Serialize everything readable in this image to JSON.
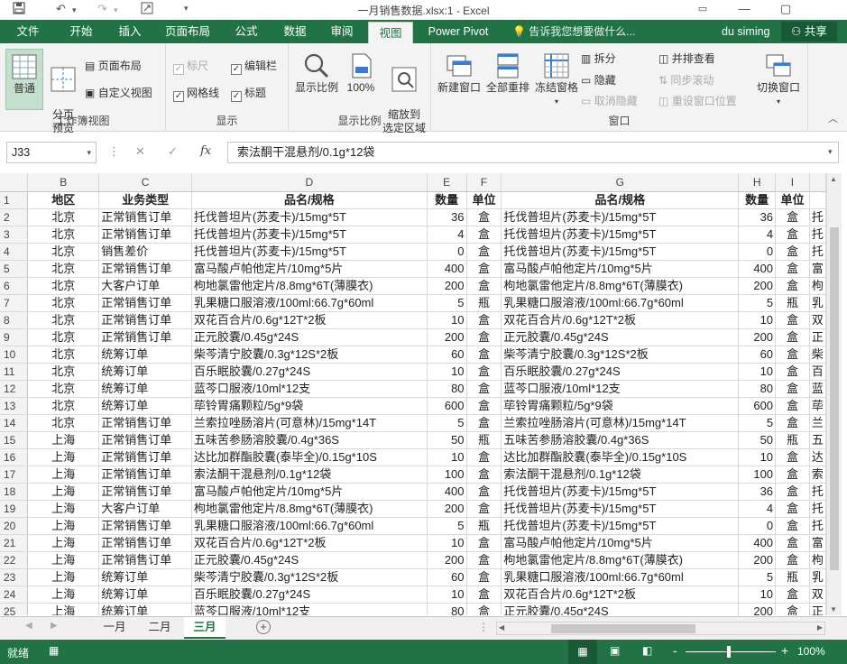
{
  "window": {
    "title": "一月销售数据.xlsx:1 - Excel",
    "minimize": "—",
    "restore": "▢",
    "ribbon_toggle": "▭"
  },
  "ribbon_tabs": [
    {
      "label": "文件"
    },
    {
      "label": "开始"
    },
    {
      "label": "插入"
    },
    {
      "label": "页面布局"
    },
    {
      "label": "公式"
    },
    {
      "label": "数据"
    },
    {
      "label": "审阅"
    },
    {
      "label": "视图"
    },
    {
      "label": "Power Pivot"
    }
  ],
  "tell_me": "告诉我您想要做什么...",
  "user": "du siming",
  "share": "共享",
  "ribbon": {
    "workbook_views": {
      "normal": "普通",
      "page_break": "分页\n预览",
      "page_layout": "页面布局",
      "custom_views": "自定义视图",
      "group_label": "工作簿视图"
    },
    "show": {
      "ruler": "标尺",
      "formula_bar": "编辑栏",
      "gridlines": "网格线",
      "headings": "标题",
      "group_label": "显示"
    },
    "zoom": {
      "zoom": "显示比例",
      "hundred": "100%",
      "zoom_to_selection": "缩放到\n选定区域",
      "group_label": "显示比例"
    },
    "window": {
      "new_window": "新建窗口",
      "arrange_all": "全部重排",
      "freeze_panes": "冻结窗格",
      "split": "拆分",
      "hide": "隐藏",
      "unhide": "取消隐藏",
      "side_by_side": "并排查看",
      "sync_scroll": "同步滚动",
      "reset_position": "重设窗口位置",
      "switch_windows": "切换窗口",
      "group_label": "窗口"
    }
  },
  "formula_bar": {
    "name_box": "J33",
    "cancel": "✕",
    "enter": "✓",
    "fx": "fx",
    "content": "索法酮干混悬剂/0.1g*12袋"
  },
  "columns": [
    "B",
    "C",
    "D",
    "E",
    "F",
    "G",
    "H",
    "I"
  ],
  "header_row": {
    "num": "1",
    "cells": [
      "地区",
      "业务类型",
      "品名/规格",
      "数量",
      "单位",
      "品名/规格",
      "数量",
      "单位"
    ]
  },
  "rows": [
    {
      "num": "2",
      "cells": [
        "北京",
        "正常销售订单",
        "托伐普坦片(苏麦卡)/15mg*5T",
        "36",
        "盒",
        "托伐普坦片(苏麦卡)/15mg*5T",
        "36",
        "盒",
        "托"
      ]
    },
    {
      "num": "3",
      "cells": [
        "北京",
        "正常销售订单",
        "托伐普坦片(苏麦卡)/15mg*5T",
        "4",
        "盒",
        "托伐普坦片(苏麦卡)/15mg*5T",
        "4",
        "盒",
        "托"
      ]
    },
    {
      "num": "4",
      "cells": [
        "北京",
        "销售差价",
        "托伐普坦片(苏麦卡)/15mg*5T",
        "0",
        "盒",
        "托伐普坦片(苏麦卡)/15mg*5T",
        "0",
        "盒",
        "托"
      ]
    },
    {
      "num": "5",
      "cells": [
        "北京",
        "正常销售订单",
        "富马酸卢帕他定片/10mg*5片",
        "400",
        "盒",
        "富马酸卢帕他定片/10mg*5片",
        "400",
        "盒",
        "富"
      ]
    },
    {
      "num": "6",
      "cells": [
        "北京",
        "大客户订单",
        "枸地氯雷他定片/8.8mg*6T(薄膜衣)",
        "200",
        "盒",
        "枸地氯雷他定片/8.8mg*6T(薄膜衣)",
        "200",
        "盒",
        "枸"
      ]
    },
    {
      "num": "7",
      "cells": [
        "北京",
        "正常销售订单",
        "乳果糖口服溶液/100ml:66.7g*60ml",
        "5",
        "瓶",
        "乳果糖口服溶液/100ml:66.7g*60ml",
        "5",
        "瓶",
        "乳"
      ]
    },
    {
      "num": "8",
      "cells": [
        "北京",
        "正常销售订单",
        "双花百合片/0.6g*12T*2板",
        "10",
        "盒",
        "双花百合片/0.6g*12T*2板",
        "10",
        "盒",
        "双"
      ]
    },
    {
      "num": "9",
      "cells": [
        "北京",
        "正常销售订单",
        "正元胶囊/0.45g*24S",
        "200",
        "盒",
        "正元胶囊/0.45g*24S",
        "200",
        "盒",
        "正"
      ]
    },
    {
      "num": "10",
      "cells": [
        "北京",
        "统筹订单",
        "柴芩清宁胶囊/0.3g*12S*2板",
        "60",
        "盒",
        "柴芩清宁胶囊/0.3g*12S*2板",
        "60",
        "盒",
        "柴"
      ]
    },
    {
      "num": "11",
      "cells": [
        "北京",
        "统筹订单",
        "百乐眠胶囊/0.27g*24S",
        "10",
        "盒",
        "百乐眠胶囊/0.27g*24S",
        "10",
        "盒",
        "百"
      ]
    },
    {
      "num": "12",
      "cells": [
        "北京",
        "统筹订单",
        "蓝芩口服液/10ml*12支",
        "80",
        "盒",
        "蓝芩口服液/10ml*12支",
        "80",
        "盒",
        "蓝"
      ]
    },
    {
      "num": "13",
      "cells": [
        "北京",
        "统筹订单",
        "荜铃胃痛颗粒/5g*9袋",
        "600",
        "盒",
        "荜铃胃痛颗粒/5g*9袋",
        "600",
        "盒",
        "荜"
      ]
    },
    {
      "num": "14",
      "cells": [
        "北京",
        "正常销售订单",
        "兰索拉唑肠溶片(可意林)/15mg*14T",
        "5",
        "盒",
        "兰索拉唑肠溶片(可意林)/15mg*14T",
        "5",
        "盒",
        "兰"
      ]
    },
    {
      "num": "15",
      "cells": [
        "上海",
        "正常销售订单",
        "五味苦参肠溶胶囊/0.4g*36S",
        "50",
        "瓶",
        "五味苦参肠溶胶囊/0.4g*36S",
        "50",
        "瓶",
        "五"
      ]
    },
    {
      "num": "16",
      "cells": [
        "上海",
        "正常销售订单",
        "达比加群酯胶囊(泰毕全)/0.15g*10S",
        "10",
        "盒",
        "达比加群酯胶囊(泰毕全)/0.15g*10S",
        "10",
        "盒",
        "达"
      ]
    },
    {
      "num": "17",
      "cells": [
        "上海",
        "正常销售订单",
        "索法酮干混悬剂/0.1g*12袋",
        "100",
        "盒",
        "索法酮干混悬剂/0.1g*12袋",
        "100",
        "盒",
        "索"
      ]
    },
    {
      "num": "18",
      "cells": [
        "上海",
        "正常销售订单",
        "富马酸卢帕他定片/10mg*5片",
        "400",
        "盒",
        "托伐普坦片(苏麦卡)/15mg*5T",
        "36",
        "盒",
        "托"
      ]
    },
    {
      "num": "19",
      "cells": [
        "上海",
        "大客户订单",
        "枸地氯雷他定片/8.8mg*6T(薄膜衣)",
        "200",
        "盒",
        "托伐普坦片(苏麦卡)/15mg*5T",
        "4",
        "盒",
        "托"
      ]
    },
    {
      "num": "20",
      "cells": [
        "上海",
        "正常销售订单",
        "乳果糖口服溶液/100ml:66.7g*60ml",
        "5",
        "瓶",
        "托伐普坦片(苏麦卡)/15mg*5T",
        "0",
        "盒",
        "托"
      ]
    },
    {
      "num": "21",
      "cells": [
        "上海",
        "正常销售订单",
        "双花百合片/0.6g*12T*2板",
        "10",
        "盒",
        "富马酸卢帕他定片/10mg*5片",
        "400",
        "盒",
        "富"
      ]
    },
    {
      "num": "22",
      "cells": [
        "上海",
        "正常销售订单",
        "正元胶囊/0.45g*24S",
        "200",
        "盒",
        "枸地氯雷他定片/8.8mg*6T(薄膜衣)",
        "200",
        "盒",
        "枸"
      ]
    },
    {
      "num": "23",
      "cells": [
        "上海",
        "统筹订单",
        "柴芩清宁胶囊/0.3g*12S*2板",
        "60",
        "盒",
        "乳果糖口服溶液/100ml:66.7g*60ml",
        "5",
        "瓶",
        "乳"
      ]
    },
    {
      "num": "24",
      "cells": [
        "上海",
        "统筹订单",
        "百乐眠胶囊/0.27g*24S",
        "10",
        "盒",
        "双花百合片/0.6g*12T*2板",
        "10",
        "盒",
        "双"
      ]
    },
    {
      "num": "25",
      "cells": [
        "上海",
        "统筹订单",
        "蓝芩口服液/10ml*12支",
        "80",
        "盒",
        "正元胶囊/0.45g*24S",
        "200",
        "盒",
        "正"
      ]
    }
  ],
  "sheet_tabs": [
    {
      "label": "一月"
    },
    {
      "label": "二月"
    },
    {
      "label": "三月"
    }
  ],
  "add_sheet": "+",
  "status": {
    "ready": "就绪",
    "zoom_minus": "-",
    "zoom_plus": "+",
    "zoom_level": "100%"
  },
  "colors": {
    "accent": "#217346",
    "ribbon_bg": "#f3f3f3"
  }
}
